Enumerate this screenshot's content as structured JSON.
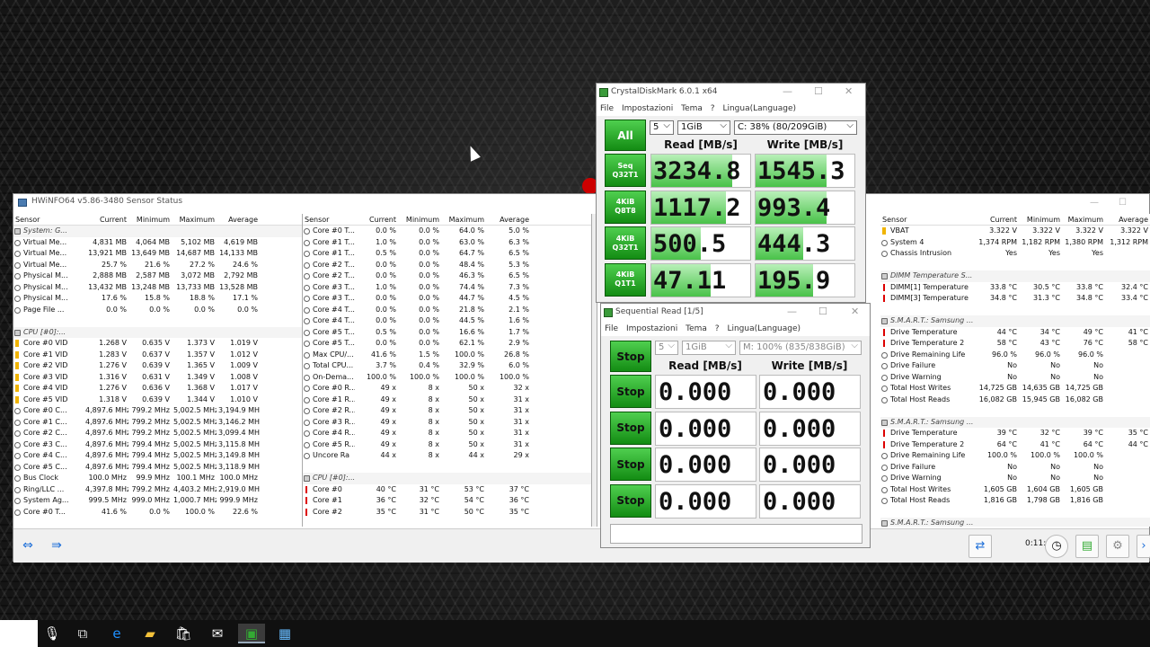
{
  "hwinfo": {
    "title": "HWiNFO64 v5.86-3480 Sensor Status",
    "columns": [
      "Sensor",
      "Current",
      "Minimum",
      "Maximum",
      "Average"
    ],
    "pane1": [
      {
        "type": "hdr",
        "icon": "chip",
        "name": "System: G..."
      },
      {
        "icon": "circle",
        "name": "Virtual Me...",
        "c": "4,831 MB",
        "mn": "4,064 MB",
        "mx": "5,102 MB",
        "av": "4,619 MB"
      },
      {
        "icon": "circle",
        "name": "Virtual Me...",
        "c": "13,921 MB",
        "mn": "13,649 MB",
        "mx": "14,687 MB",
        "av": "14,133 MB"
      },
      {
        "icon": "circle",
        "name": "Virtual Me...",
        "c": "25.7 %",
        "mn": "21.6 %",
        "mx": "27.2 %",
        "av": "24.6 %"
      },
      {
        "icon": "circle",
        "name": "Physical M...",
        "c": "2,888 MB",
        "mn": "2,587 MB",
        "mx": "3,072 MB",
        "av": "2,792 MB"
      },
      {
        "icon": "circle",
        "name": "Physical M...",
        "c": "13,432 MB",
        "mn": "13,248 MB",
        "mx": "13,733 MB",
        "av": "13,528 MB"
      },
      {
        "icon": "circle",
        "name": "Physical M...",
        "c": "17.6 %",
        "mn": "15.8 %",
        "mx": "18.8 %",
        "av": "17.1 %"
      },
      {
        "icon": "circle",
        "name": "Page File ...",
        "c": "0.0 %",
        "mn": "0.0 %",
        "mx": "0.0 %",
        "av": "0.0 %"
      },
      {
        "type": "blank"
      },
      {
        "type": "hdr",
        "icon": "chip",
        "name": "CPU [#0]:..."
      },
      {
        "icon": "bolt",
        "name": "Core #0 VID",
        "c": "1.268 V",
        "mn": "0.635 V",
        "mx": "1.373 V",
        "av": "1.019 V"
      },
      {
        "icon": "bolt",
        "name": "Core #1 VID",
        "c": "1.283 V",
        "mn": "0.637 V",
        "mx": "1.357 V",
        "av": "1.012 V"
      },
      {
        "icon": "bolt",
        "name": "Core #2 VID",
        "c": "1.276 V",
        "mn": "0.639 V",
        "mx": "1.365 V",
        "av": "1.009 V"
      },
      {
        "icon": "bolt",
        "name": "Core #3 VID",
        "c": "1.316 V",
        "mn": "0.631 V",
        "mx": "1.349 V",
        "av": "1.008 V"
      },
      {
        "icon": "bolt",
        "name": "Core #4 VID",
        "c": "1.276 V",
        "mn": "0.636 V",
        "mx": "1.368 V",
        "av": "1.017 V"
      },
      {
        "icon": "bolt",
        "name": "Core #5 VID",
        "c": "1.318 V",
        "mn": "0.639 V",
        "mx": "1.344 V",
        "av": "1.010 V"
      },
      {
        "icon": "circle",
        "name": "Core #0 C...",
        "c": "4,897.6 MHz",
        "mn": "799.2 MHz",
        "mx": "5,002.5 MHz",
        "av": "3,194.9 MHz"
      },
      {
        "icon": "circle",
        "name": "Core #1 C...",
        "c": "4,897.6 MHz",
        "mn": "799.2 MHz",
        "mx": "5,002.5 MHz",
        "av": "3,146.2 MHz"
      },
      {
        "icon": "circle",
        "name": "Core #2 C...",
        "c": "4,897.6 MHz",
        "mn": "799.2 MHz",
        "mx": "5,002.5 MHz",
        "av": "3,099.4 MHz"
      },
      {
        "icon": "circle",
        "name": "Core #3 C...",
        "c": "4,897.6 MHz",
        "mn": "799.4 MHz",
        "mx": "5,002.5 MHz",
        "av": "3,115.8 MHz"
      },
      {
        "icon": "circle",
        "name": "Core #4 C...",
        "c": "4,897.6 MHz",
        "mn": "799.4 MHz",
        "mx": "5,002.5 MHz",
        "av": "3,149.8 MHz"
      },
      {
        "icon": "circle",
        "name": "Core #5 C...",
        "c": "4,897.6 MHz",
        "mn": "799.4 MHz",
        "mx": "5,002.5 MHz",
        "av": "3,118.9 MHz"
      },
      {
        "icon": "circle",
        "name": "Bus Clock",
        "c": "100.0 MHz",
        "mn": "99.9 MHz",
        "mx": "100.1 MHz",
        "av": "100.0 MHz"
      },
      {
        "icon": "circle",
        "name": "Ring/LLC ...",
        "c": "4,397.8 MHz",
        "mn": "799.2 MHz",
        "mx": "4,403.2 MHz",
        "av": "2,919.0 MHz"
      },
      {
        "icon": "circle",
        "name": "System Ag...",
        "c": "999.5 MHz",
        "mn": "999.0 MHz",
        "mx": "1,000.7 MHz",
        "av": "999.9 MHz"
      },
      {
        "icon": "circle",
        "name": "Core #0 T...",
        "c": "41.6 %",
        "mn": "0.0 %",
        "mx": "100.0 %",
        "av": "22.6 %"
      }
    ],
    "pane2": [
      {
        "icon": "circle",
        "name": "Core #0 T...",
        "c": "0.0 %",
        "mn": "0.0 %",
        "mx": "64.0 %",
        "av": "5.0 %"
      },
      {
        "icon": "circle",
        "name": "Core #1 T...",
        "c": "1.0 %",
        "mn": "0.0 %",
        "mx": "63.0 %",
        "av": "6.3 %"
      },
      {
        "icon": "circle",
        "name": "Core #1 T...",
        "c": "0.5 %",
        "mn": "0.0 %",
        "mx": "64.7 %",
        "av": "6.5 %"
      },
      {
        "icon": "circle",
        "name": "Core #2 T...",
        "c": "0.0 %",
        "mn": "0.0 %",
        "mx": "48.4 %",
        "av": "5.3 %"
      },
      {
        "icon": "circle",
        "name": "Core #2 T...",
        "c": "0.0 %",
        "mn": "0.0 %",
        "mx": "46.3 %",
        "av": "6.5 %"
      },
      {
        "icon": "circle",
        "name": "Core #3 T...",
        "c": "1.0 %",
        "mn": "0.0 %",
        "mx": "74.4 %",
        "av": "7.3 %"
      },
      {
        "icon": "circle",
        "name": "Core #3 T...",
        "c": "0.0 %",
        "mn": "0.0 %",
        "mx": "44.7 %",
        "av": "4.5 %"
      },
      {
        "icon": "circle",
        "name": "Core #4 T...",
        "c": "0.0 %",
        "mn": "0.0 %",
        "mx": "21.8 %",
        "av": "2.1 %"
      },
      {
        "icon": "circle",
        "name": "Core #4 T...",
        "c": "0.0 %",
        "mn": "0.0 %",
        "mx": "44.5 %",
        "av": "1.6 %"
      },
      {
        "icon": "circle",
        "name": "Core #5 T...",
        "c": "0.5 %",
        "mn": "0.0 %",
        "mx": "16.6 %",
        "av": "1.7 %"
      },
      {
        "icon": "circle",
        "name": "Core #5 T...",
        "c": "0.0 %",
        "mn": "0.0 %",
        "mx": "62.1 %",
        "av": "2.9 %"
      },
      {
        "icon": "circle",
        "name": "Max CPU/...",
        "c": "41.6 %",
        "mn": "1.5 %",
        "mx": "100.0 %",
        "av": "26.8 %"
      },
      {
        "icon": "circle",
        "name": "Total CPU...",
        "c": "3.7 %",
        "mn": "0.4 %",
        "mx": "32.9 %",
        "av": "6.0 %"
      },
      {
        "icon": "circle",
        "name": "On-Dema...",
        "c": "100.0 %",
        "mn": "100.0 %",
        "mx": "100.0 %",
        "av": "100.0 %"
      },
      {
        "icon": "circle",
        "name": "Core #0 R...",
        "c": "49 x",
        "mn": "8 x",
        "mx": "50 x",
        "av": "32 x"
      },
      {
        "icon": "circle",
        "name": "Core #1 R...",
        "c": "49 x",
        "mn": "8 x",
        "mx": "50 x",
        "av": "31 x"
      },
      {
        "icon": "circle",
        "name": "Core #2 R...",
        "c": "49 x",
        "mn": "8 x",
        "mx": "50 x",
        "av": "31 x"
      },
      {
        "icon": "circle",
        "name": "Core #3 R...",
        "c": "49 x",
        "mn": "8 x",
        "mx": "50 x",
        "av": "31 x"
      },
      {
        "icon": "circle",
        "name": "Core #4 R...",
        "c": "49 x",
        "mn": "8 x",
        "mx": "50 x",
        "av": "31 x"
      },
      {
        "icon": "circle",
        "name": "Core #5 R...",
        "c": "49 x",
        "mn": "8 x",
        "mx": "50 x",
        "av": "31 x"
      },
      {
        "icon": "circle",
        "name": "Uncore Ra",
        "c": "44 x",
        "mn": "8 x",
        "mx": "44 x",
        "av": "29 x"
      },
      {
        "type": "blank"
      },
      {
        "type": "hdr",
        "icon": "chip",
        "name": "CPU [#0]:..."
      },
      {
        "icon": "therm",
        "name": "Core #0",
        "c": "40 °C",
        "mn": "31 °C",
        "mx": "53 °C",
        "av": "37 °C"
      },
      {
        "icon": "therm",
        "name": "Core #1",
        "c": "36 °C",
        "mn": "32 °C",
        "mx": "54 °C",
        "av": "36 °C"
      },
      {
        "icon": "therm",
        "name": "Core #2",
        "c": "35 °C",
        "mn": "31 °C",
        "mx": "50 °C",
        "av": "35 °C"
      }
    ],
    "pane3": [
      {
        "icon": "bolt",
        "name": "VBAT",
        "c": "3.322 V",
        "mn": "3.322 V",
        "mx": "3.322 V",
        "av": "3.322 V"
      },
      {
        "icon": "circle",
        "name": "System 4",
        "c": "1,374 RPM",
        "mn": "1,182 RPM",
        "mx": "1,380 RPM",
        "av": "1,312 RPM"
      },
      {
        "icon": "circle",
        "name": "Chassis Intrusion",
        "c": "Yes",
        "mn": "Yes",
        "mx": "Yes",
        "av": ""
      },
      {
        "type": "blank"
      },
      {
        "type": "hdr",
        "icon": "chip",
        "name": "DIMM Temperature S..."
      },
      {
        "icon": "therm",
        "name": "DIMM[1] Temperature",
        "c": "33.8 °C",
        "mn": "30.5 °C",
        "mx": "33.8 °C",
        "av": "32.4 °C"
      },
      {
        "icon": "therm",
        "name": "DIMM[3] Temperature",
        "c": "34.8 °C",
        "mn": "31.3 °C",
        "mx": "34.8 °C",
        "av": "33.4 °C"
      },
      {
        "type": "blank"
      },
      {
        "type": "hdr",
        "icon": "chip",
        "name": "S.M.A.R.T.: Samsung ..."
      },
      {
        "icon": "therm",
        "name": "Drive Temperature",
        "c": "44 °C",
        "mn": "34 °C",
        "mx": "49 °C",
        "av": "41 °C"
      },
      {
        "icon": "therm",
        "name": "Drive Temperature 2",
        "c": "58 °C",
        "mn": "43 °C",
        "mx": "76 °C",
        "av": "58 °C"
      },
      {
        "icon": "circle",
        "name": "Drive Remaining Life",
        "c": "96.0 %",
        "mn": "96.0 %",
        "mx": "96.0 %",
        "av": ""
      },
      {
        "icon": "circle",
        "name": "Drive Failure",
        "c": "No",
        "mn": "No",
        "mx": "No",
        "av": ""
      },
      {
        "icon": "circle",
        "name": "Drive Warning",
        "c": "No",
        "mn": "No",
        "mx": "No",
        "av": ""
      },
      {
        "icon": "circle",
        "name": "Total Host Writes",
        "c": "14,725 GB",
        "mn": "14,635 GB",
        "mx": "14,725 GB",
        "av": ""
      },
      {
        "icon": "circle",
        "name": "Total Host Reads",
        "c": "16,082 GB",
        "mn": "15,945 GB",
        "mx": "16,082 GB",
        "av": ""
      },
      {
        "type": "blank"
      },
      {
        "type": "hdr",
        "icon": "chip",
        "name": "S.M.A.R.T.: Samsung ..."
      },
      {
        "icon": "therm",
        "name": "Drive Temperature",
        "c": "39 °C",
        "mn": "32 °C",
        "mx": "39 °C",
        "av": "35 °C"
      },
      {
        "icon": "therm",
        "name": "Drive Temperature 2",
        "c": "64 °C",
        "mn": "41 °C",
        "mx": "64 °C",
        "av": "44 °C"
      },
      {
        "icon": "circle",
        "name": "Drive Remaining Life",
        "c": "100.0 %",
        "mn": "100.0 %",
        "mx": "100.0 %",
        "av": ""
      },
      {
        "icon": "circle",
        "name": "Drive Failure",
        "c": "No",
        "mn": "No",
        "mx": "No",
        "av": ""
      },
      {
        "icon": "circle",
        "name": "Drive Warning",
        "c": "No",
        "mn": "No",
        "mx": "No",
        "av": ""
      },
      {
        "icon": "circle",
        "name": "Total Host Writes",
        "c": "1,605 GB",
        "mn": "1,604 GB",
        "mx": "1,605 GB",
        "av": ""
      },
      {
        "icon": "circle",
        "name": "Total Host Reads",
        "c": "1,816 GB",
        "mn": "1,798 GB",
        "mx": "1,816 GB",
        "av": ""
      },
      {
        "type": "blank"
      },
      {
        "type": "hdr",
        "icon": "chip",
        "name": "S.M.A.R.T.: Samsung ..."
      }
    ],
    "elapsed": "0:11:02"
  },
  "cdm": {
    "title": "CrystalDiskMark 6.0.1 x64",
    "menu": [
      "File",
      "Impostazioni",
      "Tema",
      "?",
      "Lingua(Language)"
    ],
    "all_label": "All",
    "count": "5",
    "size": "1GiB",
    "drive": "C: 38% (80/209GiB)",
    "read_header": "Read [MB/s]",
    "write_header": "Write [MB/s]",
    "tests": [
      {
        "l1": "Seq",
        "l2": "Q32T1",
        "read": "3234.8",
        "write": "1545.3",
        "rf": 0.82,
        "wf": 0.72
      },
      {
        "l1": "4KiB",
        "l2": "Q8T8",
        "read": "1117.2",
        "write": "993.4",
        "rf": 0.75,
        "wf": 0.72
      },
      {
        "l1": "4KiB",
        "l2": "Q32T1",
        "read": "500.5",
        "write": "444.3",
        "rf": 0.5,
        "wf": 0.48
      },
      {
        "l1": "4KiB",
        "l2": "Q1T1",
        "read": "47.11",
        "write": "195.9",
        "rf": 0.6,
        "wf": 0.58
      }
    ]
  },
  "cdm2": {
    "title": "Sequential Read [1/5]",
    "menu": [
      "File",
      "Impostazioni",
      "Tema",
      "?",
      "Lingua(Language)"
    ],
    "stop_label": "Stop",
    "count": "5",
    "size": "1GiB",
    "drive": "M: 100% (835/838GiB)",
    "read_header": "Read [MB/s]",
    "write_header": "Write [MB/s]",
    "rows": [
      {
        "read": "0.000",
        "write": "0.000"
      },
      {
        "read": "0.000",
        "write": "0.000"
      },
      {
        "read": "0.000",
        "write": "0.000"
      },
      {
        "read": "0.000",
        "write": "0.000"
      }
    ]
  }
}
